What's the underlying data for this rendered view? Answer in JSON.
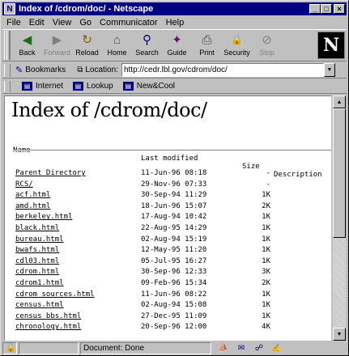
{
  "window": {
    "title": "Index of /cdrom/doc/ - Netscape",
    "minimize": "_",
    "maximize": "□",
    "close": "×"
  },
  "menu": [
    "File",
    "Edit",
    "View",
    "Go",
    "Communicator",
    "Help"
  ],
  "toolbar": [
    {
      "label": "Back",
      "icon": "◀",
      "enabled": true
    },
    {
      "label": "Forward",
      "icon": "▶",
      "enabled": false
    },
    {
      "label": "Reload",
      "icon": "↻",
      "enabled": true
    },
    {
      "label": "Home",
      "icon": "⌂",
      "enabled": true
    },
    {
      "label": "Search",
      "icon": "⚲",
      "enabled": true
    },
    {
      "label": "Guide",
      "icon": "✦",
      "enabled": true
    },
    {
      "label": "Print",
      "icon": "⎙",
      "enabled": true
    },
    {
      "label": "Security",
      "icon": "🔒",
      "enabled": true
    },
    {
      "label": "Stop",
      "icon": "⊘",
      "enabled": false
    }
  ],
  "logo": "N",
  "location": {
    "bookmarks_label": "Bookmarks",
    "location_label": "Location:",
    "url": "http://cedr.lbl.gov/cdrom/doc/"
  },
  "personal": [
    "Internet",
    "Lookup",
    "New&Cool"
  ],
  "page": {
    "heading": "Index of /cdrom/doc/",
    "headers": {
      "name": "Name",
      "modified": "Last modified",
      "size": "Size",
      "description": "Description"
    },
    "rows": [
      {
        "name": "Parent Directory",
        "date": "11-Jun-96 08:18",
        "size": "-"
      },
      {
        "name": "RCS/",
        "date": "29-Nov-96 07:33",
        "size": "-"
      },
      {
        "name": "acf.html",
        "date": "30-Sep-94 11:29",
        "size": "1K"
      },
      {
        "name": "amd.html",
        "date": "18-Jun-96 15:07",
        "size": "2K"
      },
      {
        "name": "berkeley.html",
        "date": "17-Aug-94 10:42",
        "size": "1K"
      },
      {
        "name": "black.html",
        "date": "22-Aug-95 14:29",
        "size": "1K"
      },
      {
        "name": "bureau.html",
        "date": "02-Aug-94 15:19",
        "size": "1K"
      },
      {
        "name": "bwafs.html",
        "date": "12-May-95 11:20",
        "size": "1K"
      },
      {
        "name": "cdl03.html",
        "date": "05-Jul-95 16:27",
        "size": "1K"
      },
      {
        "name": "cdrom.html",
        "date": "30-Sep-96 12:33",
        "size": "3K"
      },
      {
        "name": "cdrom1.html",
        "date": "09-Feb-96 15:34",
        "size": "2K"
      },
      {
        "name": "cdrom_sources.html",
        "date": "11-Jun-96 08:22",
        "size": "1K"
      },
      {
        "name": "census.html",
        "date": "02-Aug-94 15:08",
        "size": "1K"
      },
      {
        "name": "census_bbs.html",
        "date": "27-Dec-95 11:09",
        "size": "1K"
      },
      {
        "name": "chronology.html",
        "date": "20-Sep-96 12:00",
        "size": "4K"
      }
    ]
  },
  "status": {
    "text": "Document: Done"
  }
}
